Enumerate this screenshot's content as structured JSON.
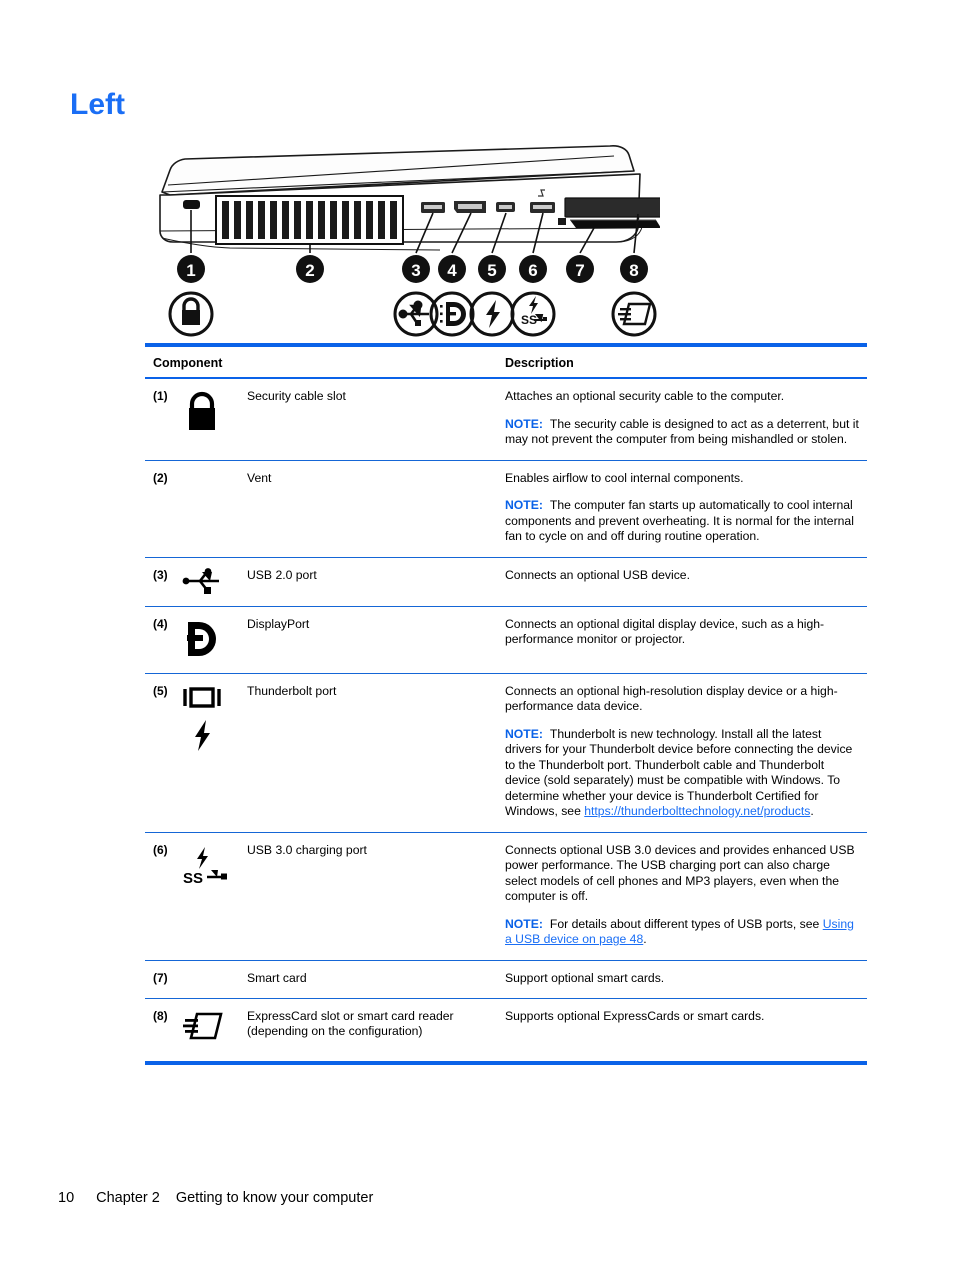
{
  "page": {
    "heading": "Left",
    "footer": {
      "page_number": "10",
      "chapter": "Chapter 2",
      "chapter_title": "Getting to know your computer"
    },
    "accent_color": "#0a62e8",
    "heading_color": "#1a6ef5"
  },
  "illustration": {
    "name": "laptop-left-side-view",
    "callouts": [
      "1",
      "2",
      "3",
      "4",
      "5",
      "6",
      "7",
      "8"
    ],
    "icon_legend": [
      "lock-icon",
      "",
      "usb-icon",
      "displayport-icon",
      "thunderbolt-icon",
      "usb-superspeed-charging-icon",
      "",
      "expresscard-icon"
    ]
  },
  "table": {
    "headers": {
      "component": "Component",
      "description": "Description"
    },
    "rows": [
      {
        "num": "(1)",
        "icon": "lock-icon",
        "name": "Security cable slot",
        "desc": "Attaches an optional security cable to the computer.",
        "note_label": "NOTE:",
        "note": "The security cable is designed to act as a deterrent, but it may not prevent the computer from being mishandled or stolen."
      },
      {
        "num": "(2)",
        "icon": "",
        "name": "Vent",
        "desc": "Enables airflow to cool internal components.",
        "note_label": "NOTE:",
        "note": "The computer fan starts up automatically to cool internal components and prevent overheating. It is normal for the internal fan to cycle on and off during routine operation."
      },
      {
        "num": "(3)",
        "icon": "usb-icon",
        "name": "USB 2.0 port",
        "desc": "Connects an optional USB device.",
        "note_label": "",
        "note": ""
      },
      {
        "num": "(4)",
        "icon": "displayport-icon",
        "name": "DisplayPort",
        "desc": "Connects an optional digital display device, such as a high-performance monitor or projector.",
        "note_label": "",
        "note": ""
      },
      {
        "num": "(5)",
        "icon": "thunderbolt-icon",
        "name": "Thunderbolt port",
        "desc": "Connects an optional high-resolution display device or a high-performance data device.",
        "note_label": "NOTE:",
        "note": "Thunderbolt is new technology. Install all the latest drivers for your Thunderbolt device before connecting the device to the Thunderbolt port. Thunderbolt cable and Thunderbolt device (sold separately) must be compatible with Windows. To determine whether your device is Thunderbolt Certified for Windows, see ",
        "note_link": "https://thunderbolttechnology.net/products",
        "note_tail": "."
      },
      {
        "num": "(6)",
        "icon": "usb-superspeed-charging-icon",
        "name": "USB 3.0 charging port",
        "desc": "Connects optional USB 3.0 devices and provides enhanced USB power performance. The USB charging port can also charge select models of cell phones and MP3 players, even when the computer is off.",
        "note_label": "NOTE:",
        "note": "For details about different types of USB ports, see ",
        "note_link": "Using a USB device on page 48",
        "note_tail": "."
      },
      {
        "num": "(7)",
        "icon": "",
        "name": "Smart card",
        "desc": "Support optional smart cards.",
        "note_label": "",
        "note": ""
      },
      {
        "num": "(8)",
        "icon": "expresscard-icon",
        "name": "ExpressCard slot or smart card reader (depending on the configuration)",
        "desc": "Supports optional ExpressCards or smart cards.",
        "note_label": "",
        "note": ""
      }
    ]
  }
}
